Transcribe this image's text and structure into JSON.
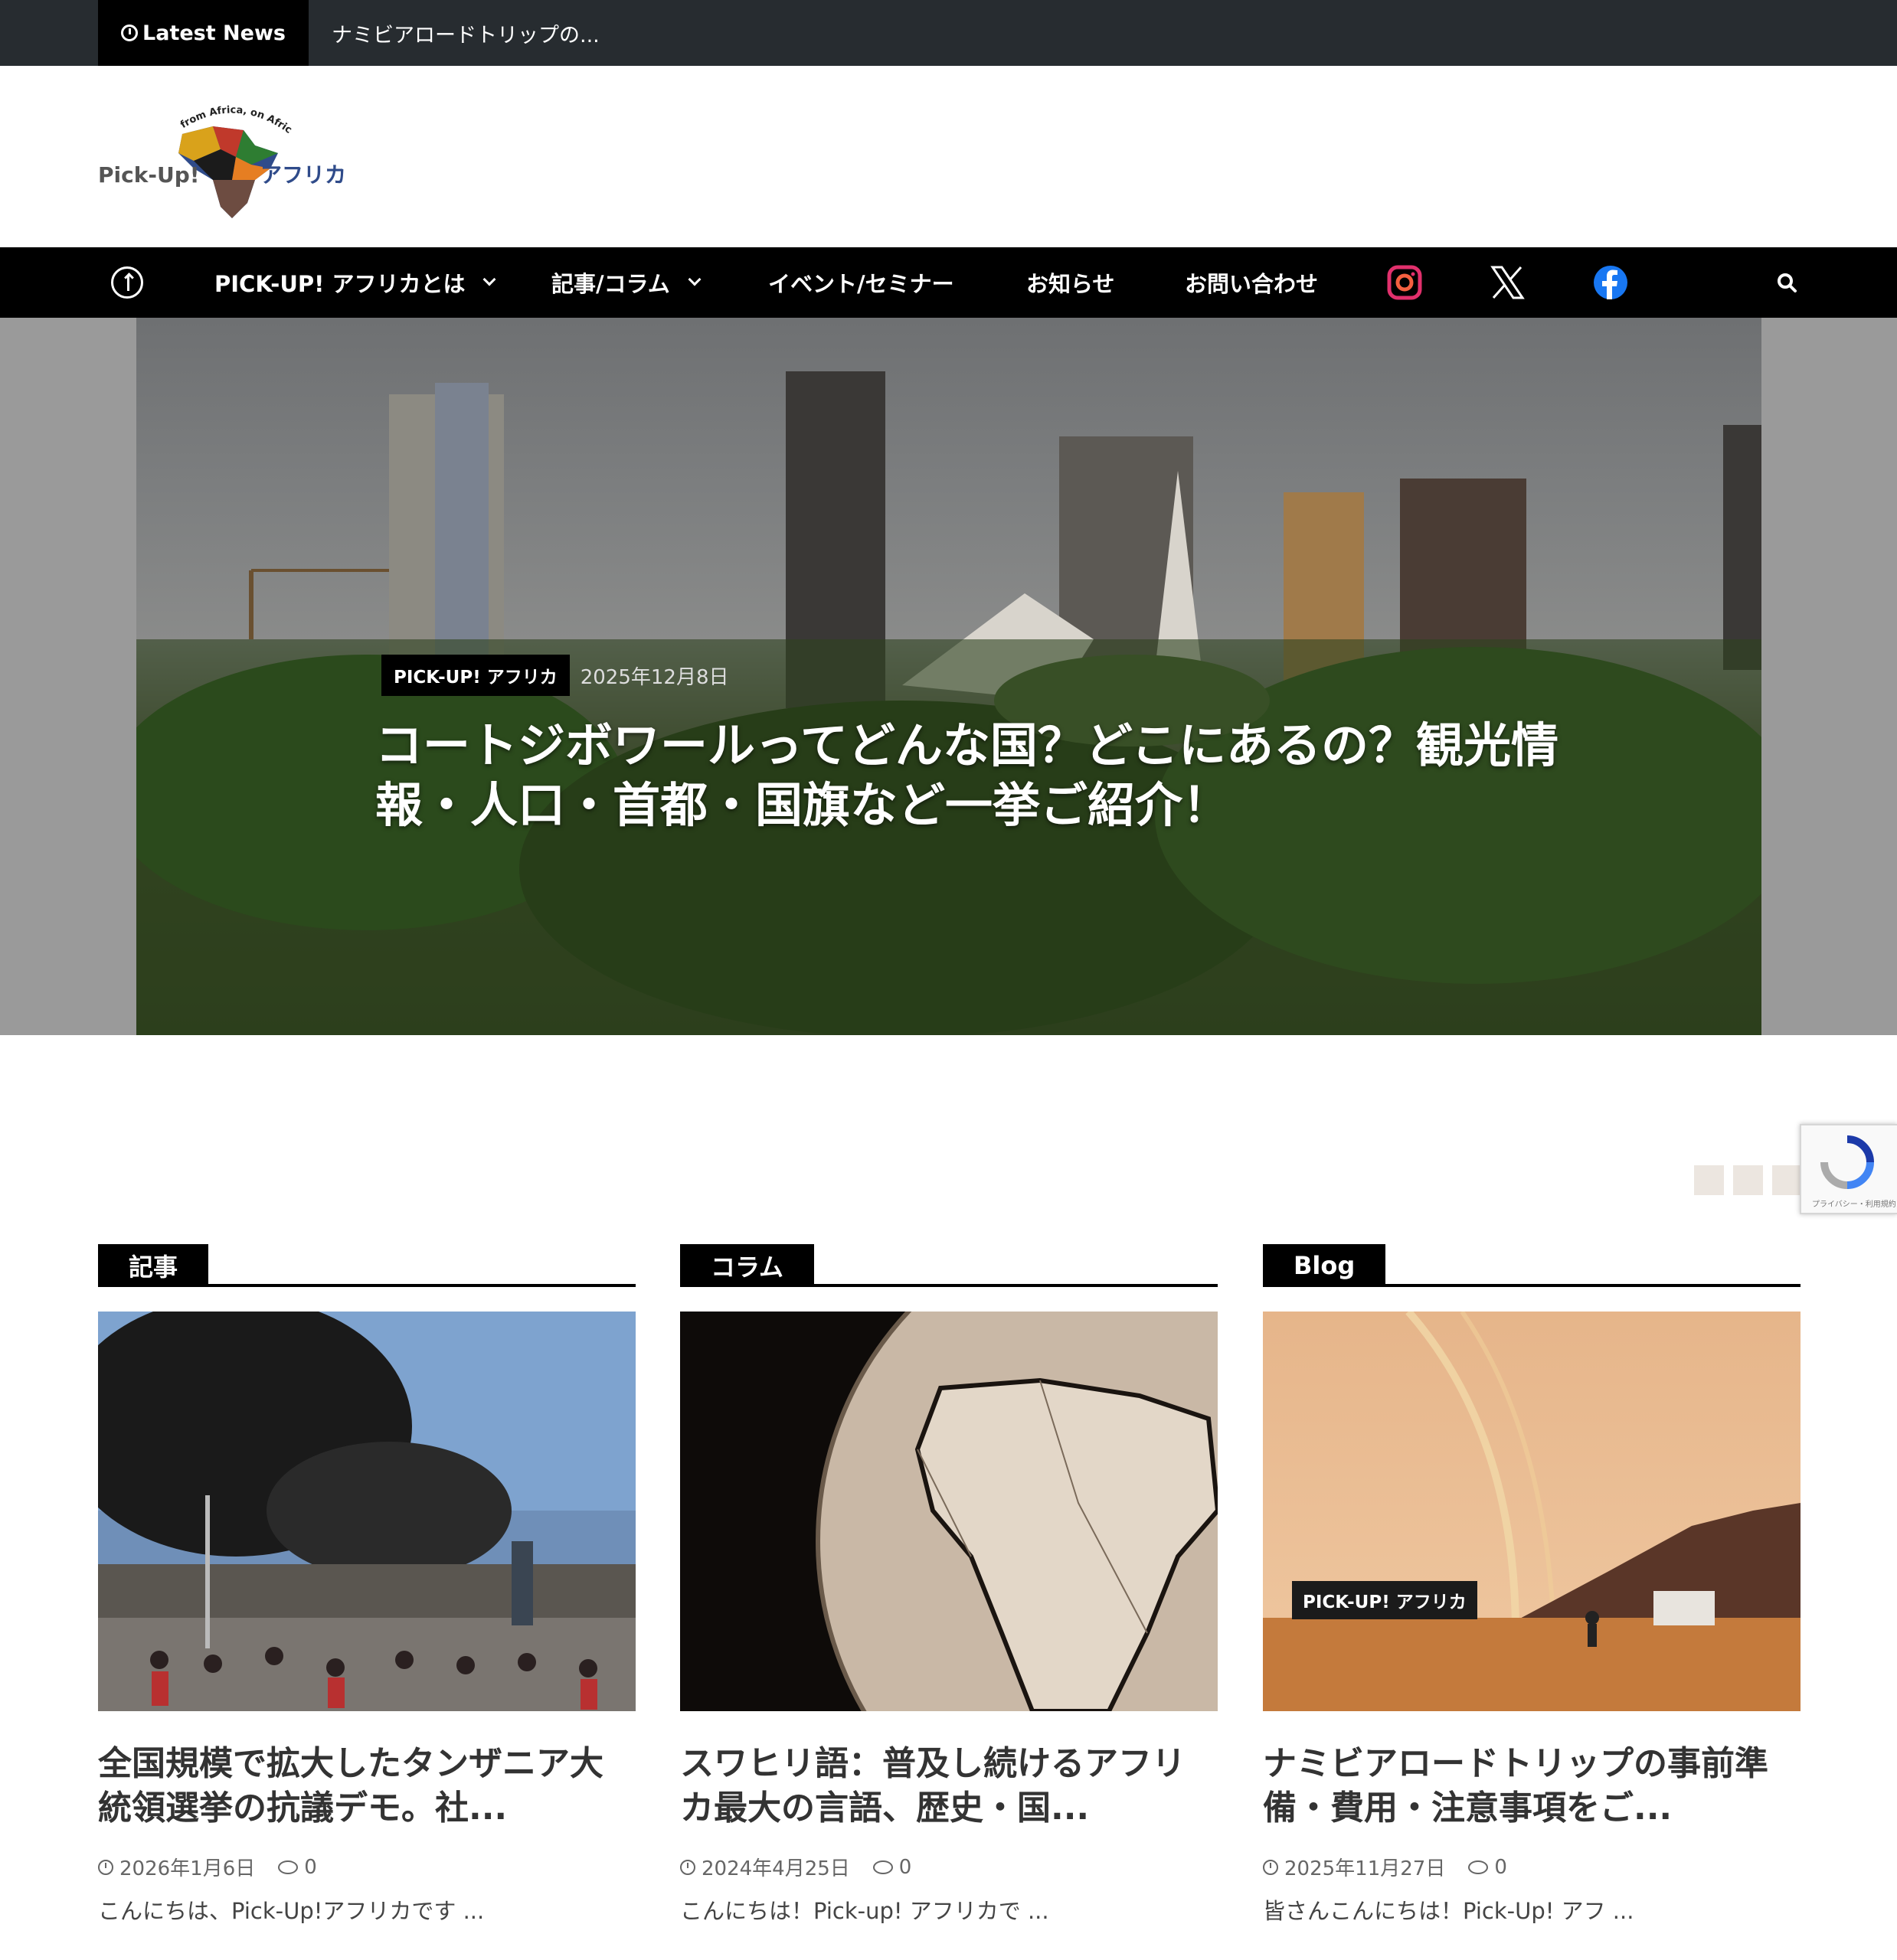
{
  "topbar": {
    "latest_label": "Latest News",
    "ticker_text": "ナミビアロードトリップの..."
  },
  "logo": {
    "arc_text": "from Africa, on Africa",
    "brand_left": "Pick-Up!",
    "brand_right": "アフリカ"
  },
  "nav": {
    "items": [
      {
        "label": "PICK-UP! アフリカとは"
      },
      {
        "label": "記事/コラム"
      },
      {
        "label": "イベント/セミナー"
      },
      {
        "label": "お知らせ"
      },
      {
        "label": "お問い合わせ"
      }
    ],
    "social_icons": [
      "instagram-icon",
      "x-icon",
      "facebook-icon"
    ]
  },
  "hero": {
    "category": "PICK-UP! アフリカ",
    "date": "2025年12月8日",
    "title": "コートジボワールってどんな国？どこにあるの？観光情報・人口・首都・国旗など一挙ご紹介！"
  },
  "recaptcha": {
    "text": "プライバシー・利用規約"
  },
  "columns": [
    {
      "tab": "記事",
      "title": "全国規模で拡大したタンザニア大統領選挙の抗議デモ。社...",
      "date": "2026年1月6日",
      "comments": "0",
      "excerpt": "こんにちは、Pick-Up!アフリカです ..."
    },
    {
      "tab": "コラム",
      "title": "スワヒリ語：普及し続けるアフリカ最大の言語、歴史・国...",
      "date": "2024年4月25日",
      "comments": "0",
      "excerpt": "こんにちは！Pick-up! アフリカで ..."
    },
    {
      "tab": "Blog",
      "badge": "PICK-UP! アフリカ",
      "title": "ナミビアロードトリップの事前準備・費用・注意事項をご...",
      "date": "2025年11月27日",
      "comments": "0",
      "excerpt": "皆さんこんにちは！Pick-Up! アフ ..."
    }
  ],
  "colors": {
    "topbar": "#272c30",
    "nav": "#000000",
    "instagram": "#e1306c",
    "facebook": "#1877f2"
  }
}
